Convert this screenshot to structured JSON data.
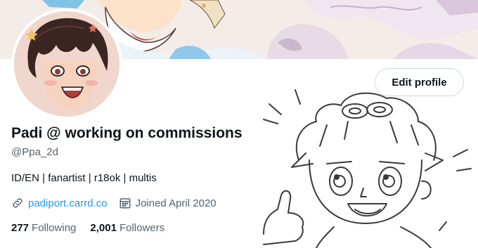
{
  "profile": {
    "display_name": "Padi @ working on commissions",
    "handle": "@Ppa_2d",
    "bio": "ID/EN | fanartist | r18ok | multis",
    "website": "padiport.carrd.co",
    "joined": "Joined April 2020",
    "edit_label": "Edit profile"
  },
  "stats": {
    "following_count": "277",
    "following_label": "Following",
    "followers_count": "2,001",
    "followers_label": "Followers"
  },
  "icons": {
    "link": "link-icon",
    "calendar": "calendar-icon"
  },
  "colors": {
    "link": "#1d9bf0",
    "secondary_text": "#536471",
    "primary_text": "#0f1419"
  }
}
